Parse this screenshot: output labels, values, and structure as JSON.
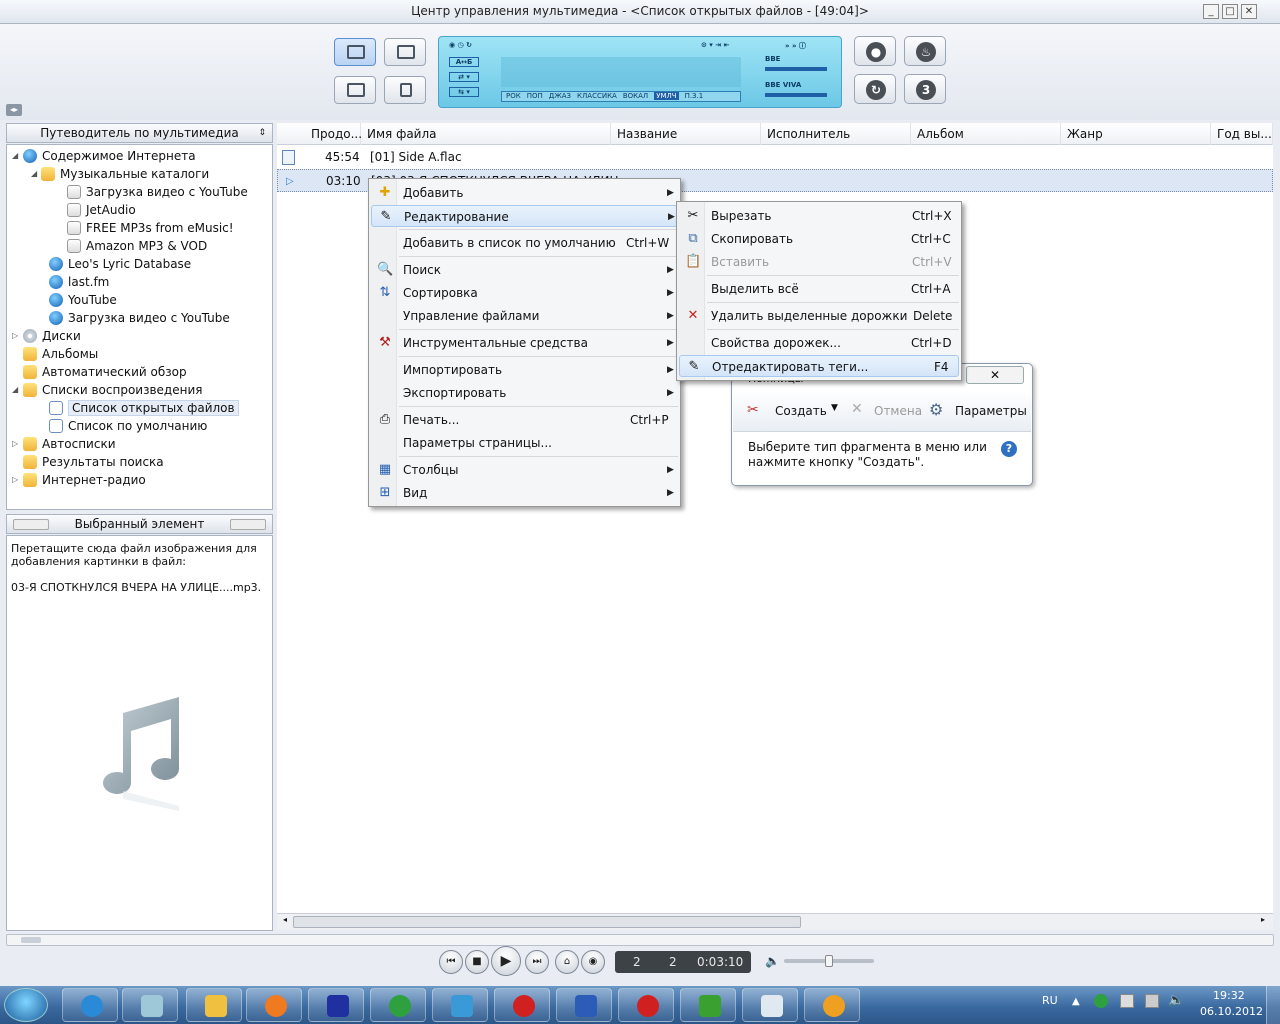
{
  "window": {
    "title": "Центр управления мультимедиа - <Список открытых файлов - [49:04]>",
    "controls": [
      "_",
      "□",
      "✕"
    ]
  },
  "lcd": {
    "ab_label": "A↔Б",
    "genres": [
      "РОК",
      "ПОП",
      "ДЖАЗ",
      "КЛАССИКА",
      "ВОКАЛ",
      "УМЛЧ",
      "П.З.1"
    ],
    "selected_genre": "УМЛЧ",
    "dsp_1": "BBE",
    "dsp_2": "BBE VIVA"
  },
  "nav": {
    "header": "Путеводитель по мультимедиа",
    "items": [
      {
        "label": "Содержимое Интернета"
      },
      {
        "label": "Музыкальные каталоги"
      },
      {
        "label": "Загрузка видео с YouTube"
      },
      {
        "label": "JetAudio"
      },
      {
        "label": "FREE MP3s from eMusic!"
      },
      {
        "label": "Amazon MP3 & VOD"
      },
      {
        "label": "Leo's Lyric Database"
      },
      {
        "label": "last.fm"
      },
      {
        "label": "YouTube"
      },
      {
        "label": "Загрузка видео с YouTube"
      },
      {
        "label": "Диски"
      },
      {
        "label": "Альбомы"
      },
      {
        "label": "Автоматический обзор"
      },
      {
        "label": "Списки воспроизведения"
      },
      {
        "label": "Список открытых файлов"
      },
      {
        "label": "Список по умолчанию"
      },
      {
        "label": "Автосписки"
      },
      {
        "label": "Результаты поиска"
      },
      {
        "label": "Интернет-радио"
      }
    ]
  },
  "selected_pane": {
    "header": "Выбранный элемент",
    "hint_line1": "Перетащите сюда файл изображения для",
    "hint_line2": "добавления картинки в файл:",
    "filename": "03-Я СПОТКНУЛСЯ ВЧЕРА НА УЛИЦЕ....mp3."
  },
  "list": {
    "columns": [
      "Продо...",
      "Имя файла",
      "Название",
      "Исполнитель",
      "Альбом",
      "Жанр",
      "Год вы..."
    ],
    "rows": [
      {
        "duration": "45:54",
        "filename": "[01] Side A.flac"
      },
      {
        "duration": "03:10",
        "filename": "[03] 03-Я СПОТКНУЛСЯ ВЧЕРА НА УЛИЦ..."
      }
    ]
  },
  "context_menu": {
    "items": [
      {
        "label": "Добавить",
        "shortcut": ""
      },
      {
        "label": "Редактирование",
        "shortcut": ""
      },
      {
        "label": "Добавить в список по умолчанию",
        "shortcut": "Ctrl+W"
      },
      {
        "label": "Поиск",
        "shortcut": ""
      },
      {
        "label": "Сортировка",
        "shortcut": ""
      },
      {
        "label": "Управление файлами",
        "shortcut": ""
      },
      {
        "label": "Инструментальные средства",
        "shortcut": ""
      },
      {
        "label": "Импортировать",
        "shortcut": ""
      },
      {
        "label": "Экспортировать",
        "shortcut": ""
      },
      {
        "label": "Печать...",
        "shortcut": "Ctrl+P"
      },
      {
        "label": "Параметры страницы...",
        "shortcut": ""
      },
      {
        "label": "Столбцы",
        "shortcut": ""
      },
      {
        "label": "Вид",
        "shortcut": ""
      }
    ]
  },
  "edit_submenu": {
    "items": [
      {
        "label": "Вырезать",
        "shortcut": "Ctrl+X"
      },
      {
        "label": "Скопировать",
        "shortcut": "Ctrl+C"
      },
      {
        "label": "Вставить",
        "shortcut": "Ctrl+V"
      },
      {
        "label": "Выделить всё",
        "shortcut": "Ctrl+A"
      },
      {
        "label": "Удалить выделенные дорожки",
        "shortcut": "Delete"
      },
      {
        "label": "Свойства дорожек...",
        "shortcut": "Ctrl+D"
      },
      {
        "label": "Отредактировать теги...",
        "shortcut": "F4"
      }
    ]
  },
  "snipping": {
    "title": "Ножницы",
    "create": "Создать",
    "cancel": "Отмена",
    "options": "Параметры",
    "hint_line1": "Выберите тип фрагмента в меню или",
    "hint_line2": "нажмите кнопку \"Создать\"."
  },
  "player": {
    "lcd_a": "2",
    "lcd_b": "2",
    "lcd_time": "0:03:10",
    "volume_fraction": 0.5
  },
  "taskbar": {
    "lang": "RU",
    "time": "19:32",
    "date": "06.10.2012"
  }
}
